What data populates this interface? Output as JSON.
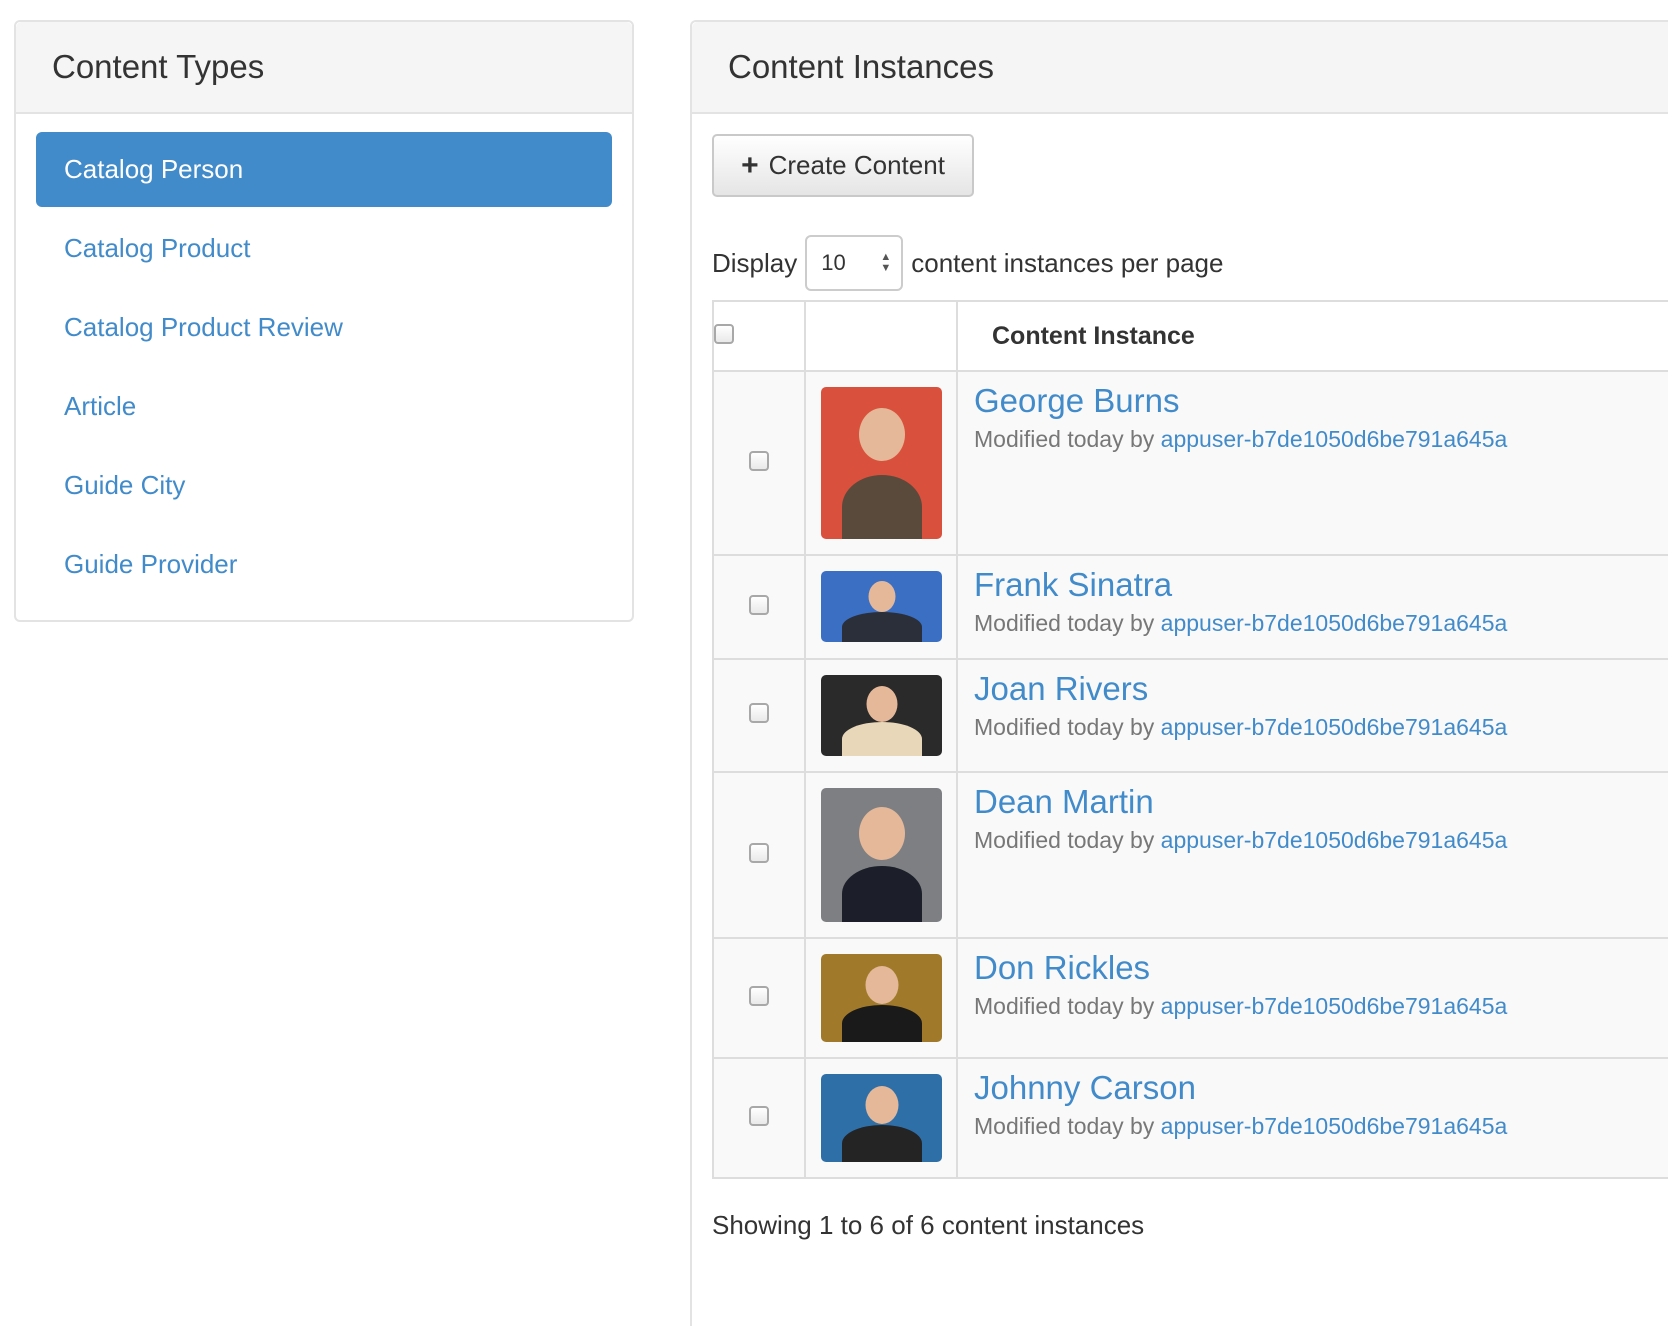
{
  "content_types": {
    "title": "Content Types",
    "items": [
      {
        "label": "Catalog Person",
        "active": true
      },
      {
        "label": "Catalog Product",
        "active": false
      },
      {
        "label": "Catalog Product Review",
        "active": false
      },
      {
        "label": "Article",
        "active": false
      },
      {
        "label": "Guide City",
        "active": false
      },
      {
        "label": "Guide Provider",
        "active": false
      }
    ]
  },
  "instances": {
    "title": "Content Instances",
    "create_label": "Create Content",
    "display_label": "Display",
    "per_page_value": "10",
    "per_page_suffix": "content instances per page",
    "column_header": "Content Instance",
    "meta_prefix": "Modified today by ",
    "rows": [
      {
        "name": "George Burns",
        "user": "appuser-b7de1050d6be791a645a",
        "thumb_bg": "#d9513c",
        "thumb_fg": "#5a4a3c"
      },
      {
        "name": "Frank Sinatra",
        "user": "appuser-b7de1050d6be791a645a",
        "thumb_bg": "#3a6fc4",
        "thumb_fg": "#2a2f3a"
      },
      {
        "name": "Joan Rivers",
        "user": "appuser-b7de1050d6be791a645a",
        "thumb_bg": "#2a2a2a",
        "thumb_fg": "#e8d7b8"
      },
      {
        "name": "Dean Martin",
        "user": "appuser-b7de1050d6be791a645a",
        "thumb_bg": "#7d7f82",
        "thumb_fg": "#1c1f2a"
      },
      {
        "name": "Don Rickles",
        "user": "appuser-b7de1050d6be791a645a",
        "thumb_bg": "#a07a2a",
        "thumb_fg": "#1a1a1a"
      },
      {
        "name": "Johnny Carson",
        "user": "appuser-b7de1050d6be791a645a",
        "thumb_bg": "#2f6fa8",
        "thumb_fg": "#242424"
      }
    ],
    "footer": "Showing 1 to 6 of 6 content instances"
  }
}
